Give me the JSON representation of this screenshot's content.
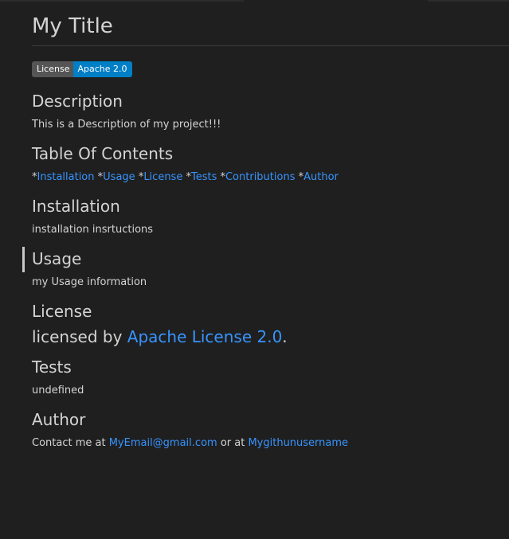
{
  "title": "My Title",
  "badge": {
    "label": "License",
    "value": "Apache 2.0",
    "label_color": "#555555",
    "value_color": "#007ec6"
  },
  "sections": {
    "description": {
      "heading": "Description",
      "text": "This is a Description of my project!!!"
    },
    "toc": {
      "heading": "Table Of Contents",
      "bullet": "*",
      "links": [
        "Installation",
        "Usage",
        "License",
        "Tests",
        "Contributions",
        "Author"
      ]
    },
    "installation": {
      "heading": "Installation",
      "text": "installation insrtuctions"
    },
    "usage": {
      "heading": "Usage",
      "text": "my Usage information"
    },
    "license": {
      "heading": "License",
      "prefix": "licensed by ",
      "link": "Apache License 2.0",
      "suffix": "."
    },
    "tests": {
      "heading": "Tests",
      "text": "undefined"
    },
    "author": {
      "heading": "Author",
      "prefix": "Contact me at ",
      "email": "MyEmail@gmail.com",
      "middle": " or at ",
      "github": "Mygithunusername"
    }
  },
  "colors": {
    "background": "#1f1f1f",
    "text": "#d4d4d4",
    "link": "#3794ff"
  }
}
